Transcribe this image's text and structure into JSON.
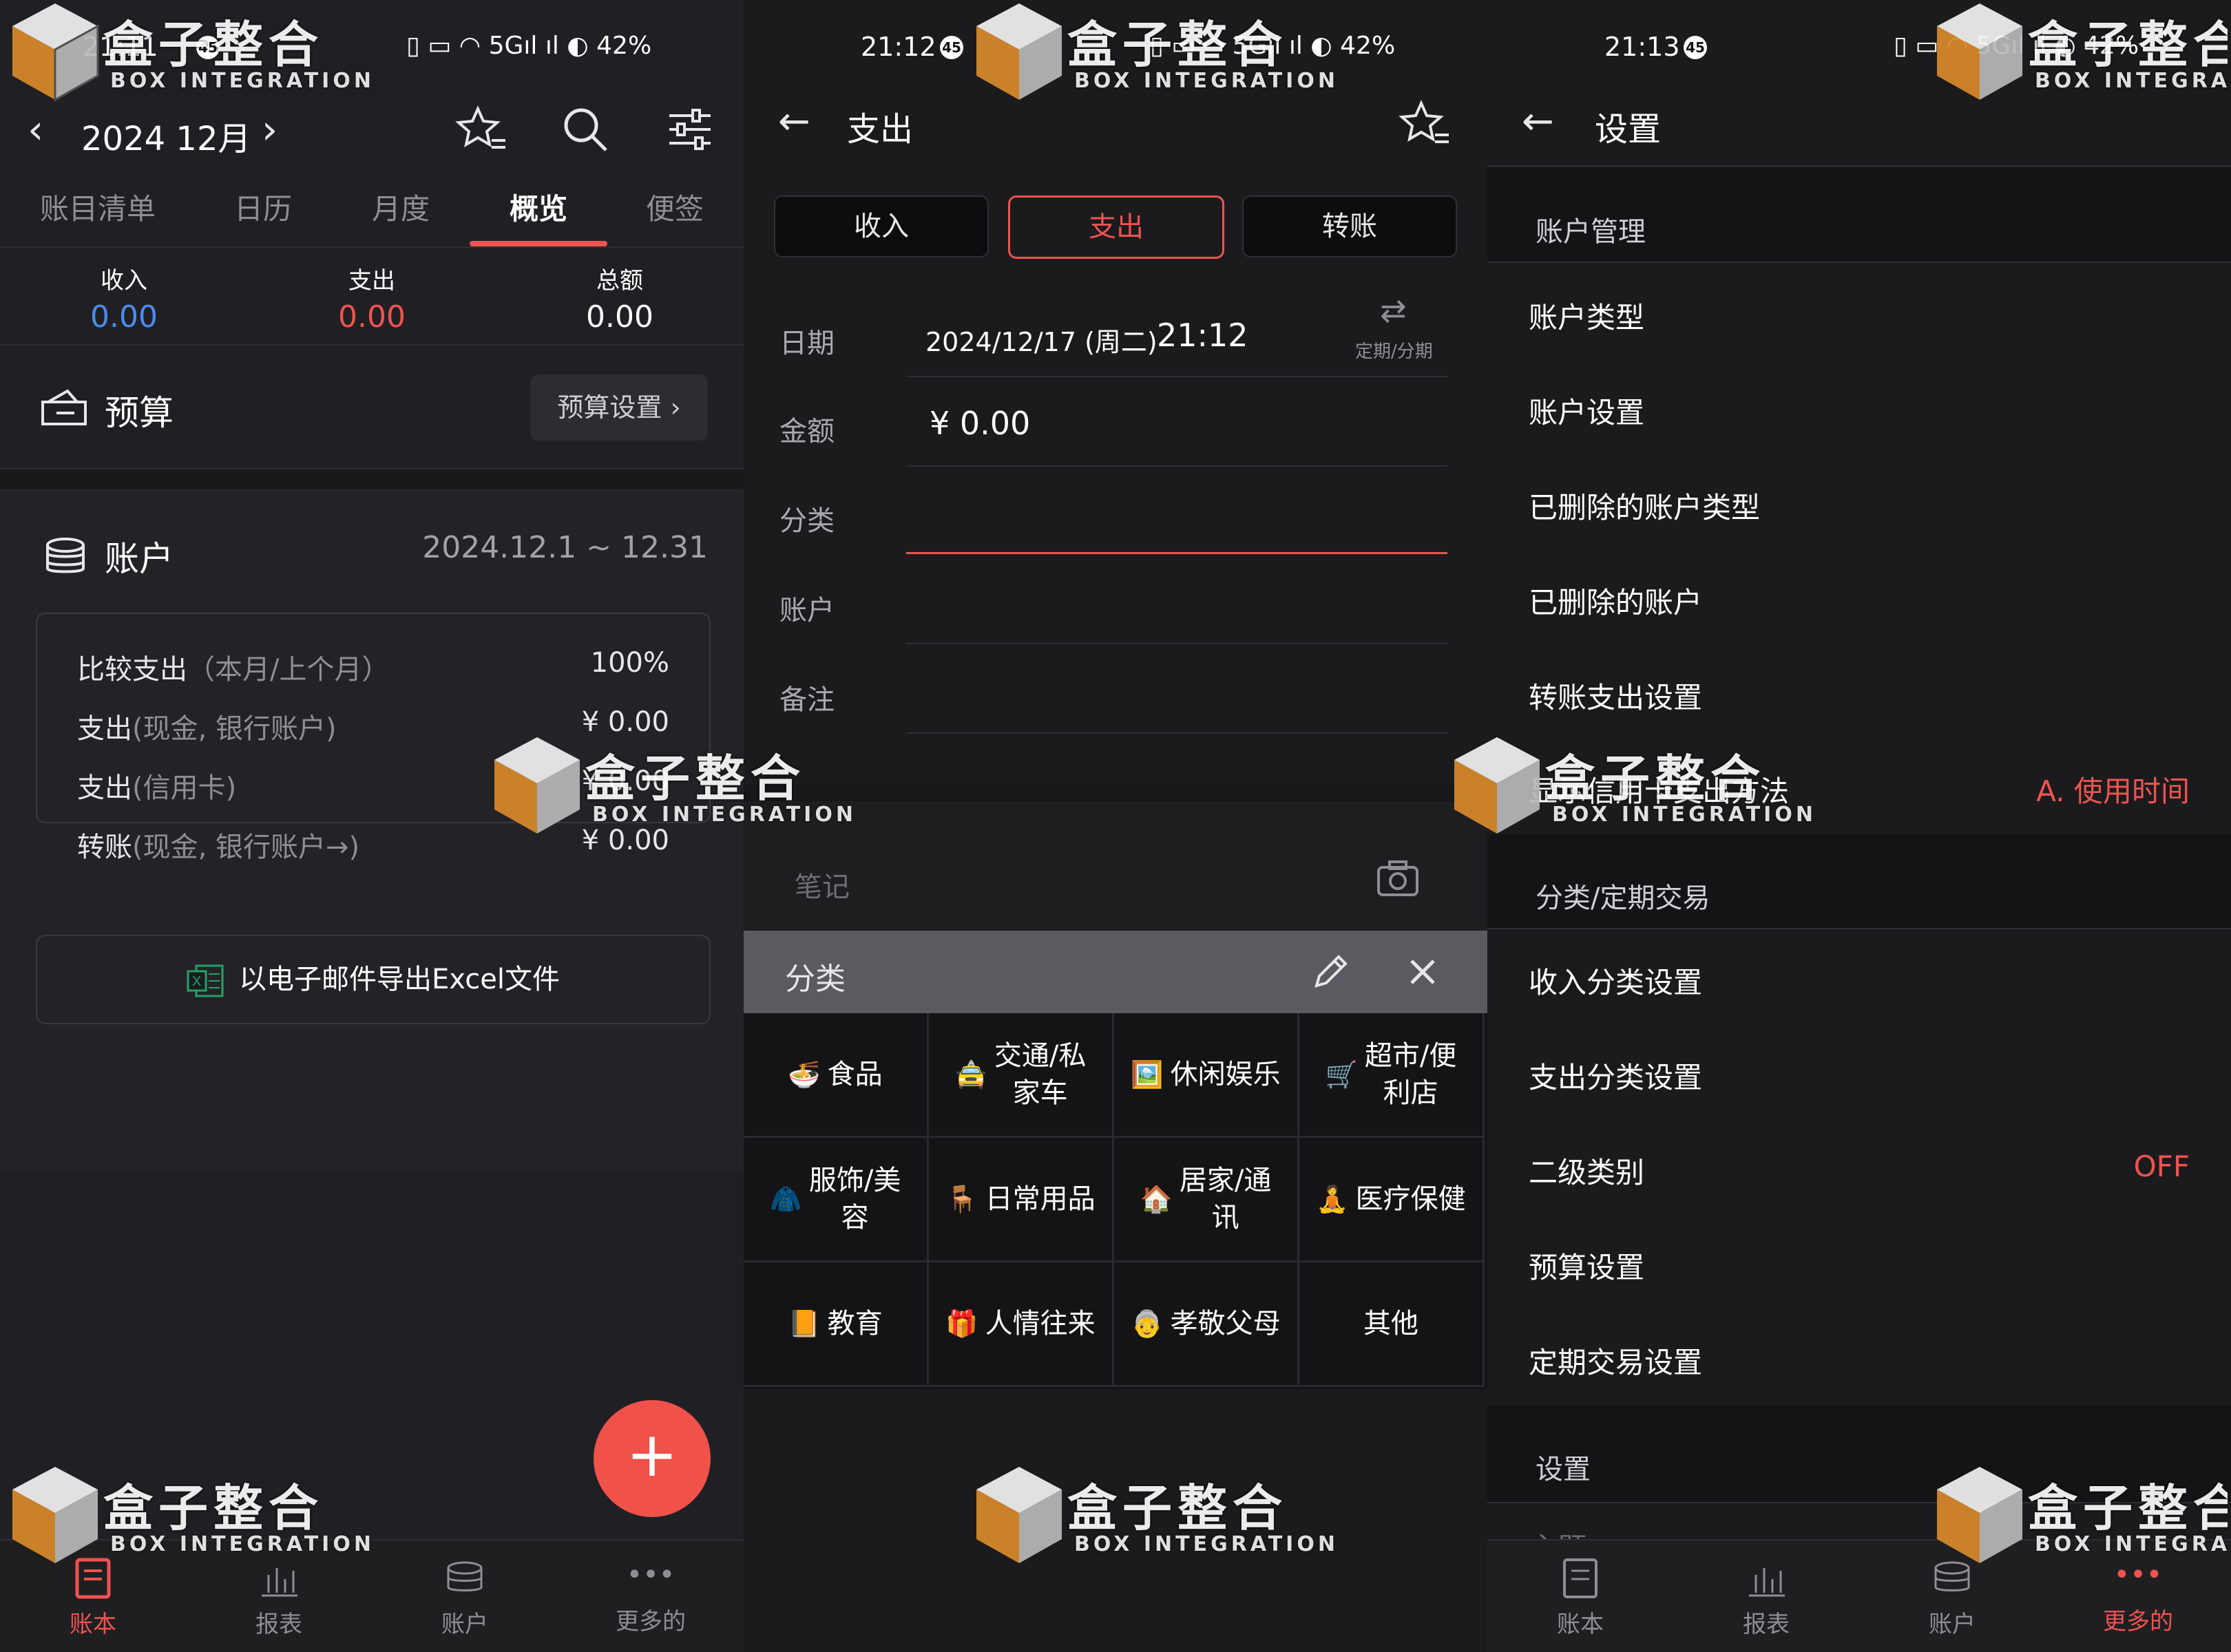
{
  "status": {
    "s1_time": "21:11",
    "s2_time": "21:12",
    "s3_time": "21:13",
    "notif_count": "45",
    "battery": "42%",
    "signal": "5G"
  },
  "watermark": {
    "cn": "盒子整合",
    "en": "BOX INTEGRATION"
  },
  "screen1": {
    "month": "2024 12月",
    "tabs": [
      "账目清单",
      "日历",
      "月度",
      "概览",
      "便签"
    ],
    "active_tab": "概览",
    "summary": {
      "income_label": "收入",
      "income_value": "0.00",
      "expense_label": "支出",
      "expense_value": "0.00",
      "total_label": "总额",
      "total_value": "0.00"
    },
    "budget_title": "预算",
    "budget_button": "预算设置 ›",
    "account_title": "账户",
    "range": "2024.12.1 ~ 12.31",
    "rows": [
      {
        "label": "比较支出",
        "sub": "（本月/上个月）",
        "value": "100%"
      },
      {
        "label": "支出",
        "sub": "(现金, 银行账户)",
        "value": "¥ 0.00"
      },
      {
        "label": "支出",
        "sub": "(信用卡)",
        "value": "¥ 0.00"
      },
      {
        "label": "转账",
        "sub": "(现金, 银行账户→)",
        "value": "¥ 0.00"
      }
    ],
    "excel_label": "以电子邮件导出Excel文件",
    "fab": "+"
  },
  "nav": {
    "items": [
      "账本",
      "报表",
      "账户",
      "更多的"
    ]
  },
  "screen2": {
    "title": "支出",
    "types": [
      "收入",
      "支出",
      "转账"
    ],
    "active_type": "支出",
    "fields": {
      "date": "日期",
      "amount": "金额",
      "category": "分类",
      "account": "账户",
      "memo": "备注"
    },
    "date_value": "2024/12/17 (周二)",
    "time_value": "21:12",
    "repeat_label": "定期/分期",
    "amount_value": "¥ 0.00",
    "notes_placeholder": "笔记",
    "panel_title": "分类",
    "categories": [
      {
        "emoji": "🍜",
        "label": "食品"
      },
      {
        "emoji": "🚖",
        "label": "交通/私\n家车"
      },
      {
        "emoji": "🖼️",
        "label": "休闲娱乐"
      },
      {
        "emoji": "🛒",
        "label": "超市/便\n利店"
      },
      {
        "emoji": "🧥",
        "label": "服饰/美\n容"
      },
      {
        "emoji": "🪑",
        "label": "日常用品"
      },
      {
        "emoji": "🏠",
        "label": "居家/通\n讯"
      },
      {
        "emoji": "🧘",
        "label": "医疗保健"
      },
      {
        "emoji": "📙",
        "label": "教育"
      },
      {
        "emoji": "🎁",
        "label": "人情往来"
      },
      {
        "emoji": "👵",
        "label": "孝敬父母"
      },
      {
        "emoji": "",
        "label": "其他"
      }
    ]
  },
  "screen3": {
    "title": "设置",
    "group1": "账户管理",
    "items1": [
      "账户类型",
      "账户设置",
      "已删除的账户类型",
      "已删除的账户",
      "转账支出设置",
      "显示信用卡支出方法"
    ],
    "credit_method_value": "A. 使用时间",
    "group2": "分类/定期交易",
    "items2": [
      "收入分类设置",
      "支出分类设置",
      "二级类别",
      "预算设置",
      "定期交易设置"
    ],
    "subcat_value": "OFF",
    "group3": "设置",
    "partial_item": "主题",
    "active_nav": "更多的"
  },
  "colors": {
    "accent": "#ef5350",
    "income": "#4a8cf0",
    "expense": "#ef5350"
  }
}
